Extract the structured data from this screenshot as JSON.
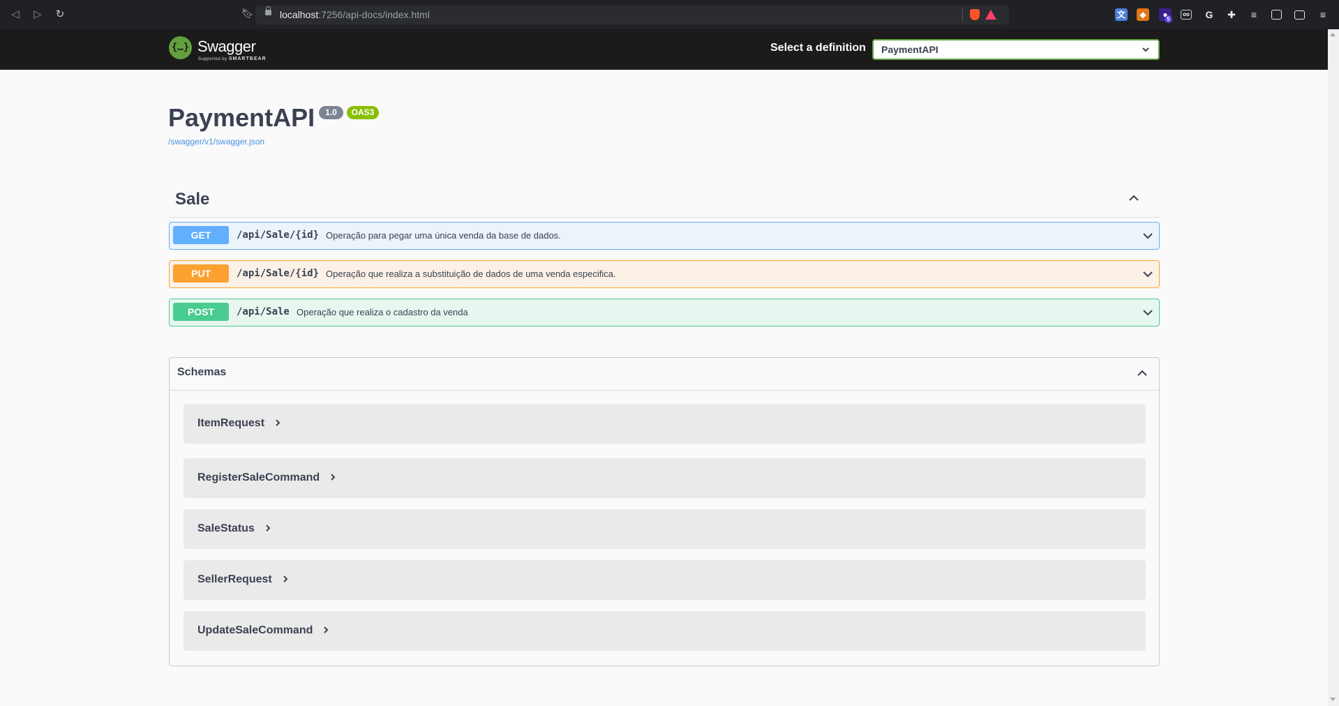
{
  "browser": {
    "url_host": "localhost",
    "url_rest": ":7256/api-docs/index.html",
    "extension_icons": [
      "translate-icon",
      "metamask-icon",
      "wallet-icon",
      "glasses-icon",
      "grammarly-icon",
      "extensions-icon",
      "playlist-icon",
      "sidebar-icon",
      "wallet-card-icon",
      "menu-icon"
    ],
    "extension_badge": "5"
  },
  "topbar": {
    "logo_text": "Swagger",
    "logo_sub_prefix": "Supported by",
    "logo_sub_brand": "SMARTBEAR",
    "definition_label": "Select a definition",
    "definition_selected": "PaymentAPI"
  },
  "info": {
    "title": "PaymentAPI",
    "version": "1.0",
    "oas": "OAS3",
    "spec_link": "/swagger/v1/swagger.json"
  },
  "tag": {
    "name": "Sale",
    "operations": [
      {
        "method": "GET",
        "path": "/api/Sale/{id}",
        "description": "Operação para pegar uma única venda da base de dados.",
        "color": "#61affe"
      },
      {
        "method": "PUT",
        "path": "/api/Sale/{id}",
        "description": "Operação que realiza a substituição de dados de uma venda especifica.",
        "color": "#fca130"
      },
      {
        "method": "POST",
        "path": "/api/Sale",
        "description": "Operação que realiza o cadastro da venda",
        "color": "#49cc90"
      }
    ]
  },
  "schemas": {
    "title": "Schemas",
    "models": [
      "ItemRequest",
      "RegisterSaleCommand",
      "SaleStatus",
      "SellerRequest",
      "UpdateSaleCommand"
    ]
  }
}
